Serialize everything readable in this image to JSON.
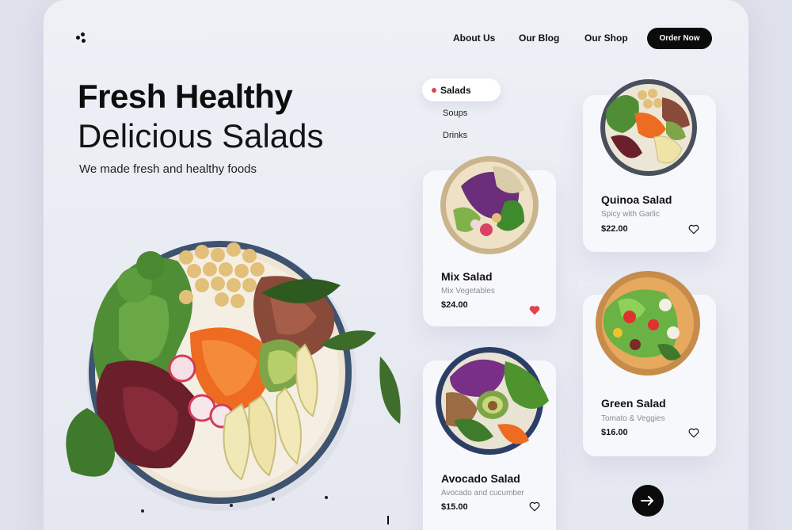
{
  "nav": {
    "logo": "logo-icon",
    "links": [
      "About Us",
      "Our Blog",
      "Our Shop"
    ],
    "cta": "Order Now"
  },
  "hero": {
    "line1": "Fresh Healthy",
    "line2": "Delicious Salads",
    "subtitle": "We made fresh and healthy foods"
  },
  "categories": {
    "active": "Salads",
    "items": [
      "Soups",
      "Drinks"
    ]
  },
  "cards": [
    {
      "name": "Mix Salad",
      "desc": "Mix Vegetables",
      "price": "$24.00",
      "favorited": true
    },
    {
      "name": "Avocado Salad",
      "desc": "Avocado and  cucumber",
      "price": "$15.00",
      "favorited": false
    },
    {
      "name": "Quinoa Salad",
      "desc": "Spicy with Garlic",
      "price": "$22.00",
      "favorited": false
    },
    {
      "name": "Green Salad",
      "desc": "Tomato & Veggies",
      "price": "$16.00",
      "favorited": false
    }
  ],
  "colors": {
    "accent_dot": "#e0434e",
    "heart_filled": "#e0434e",
    "button_bg": "#0b0b0b",
    "page_bg": "#eef0f6"
  },
  "icons": [
    "logo-icon",
    "heart-icon",
    "arrow-right-icon"
  ]
}
